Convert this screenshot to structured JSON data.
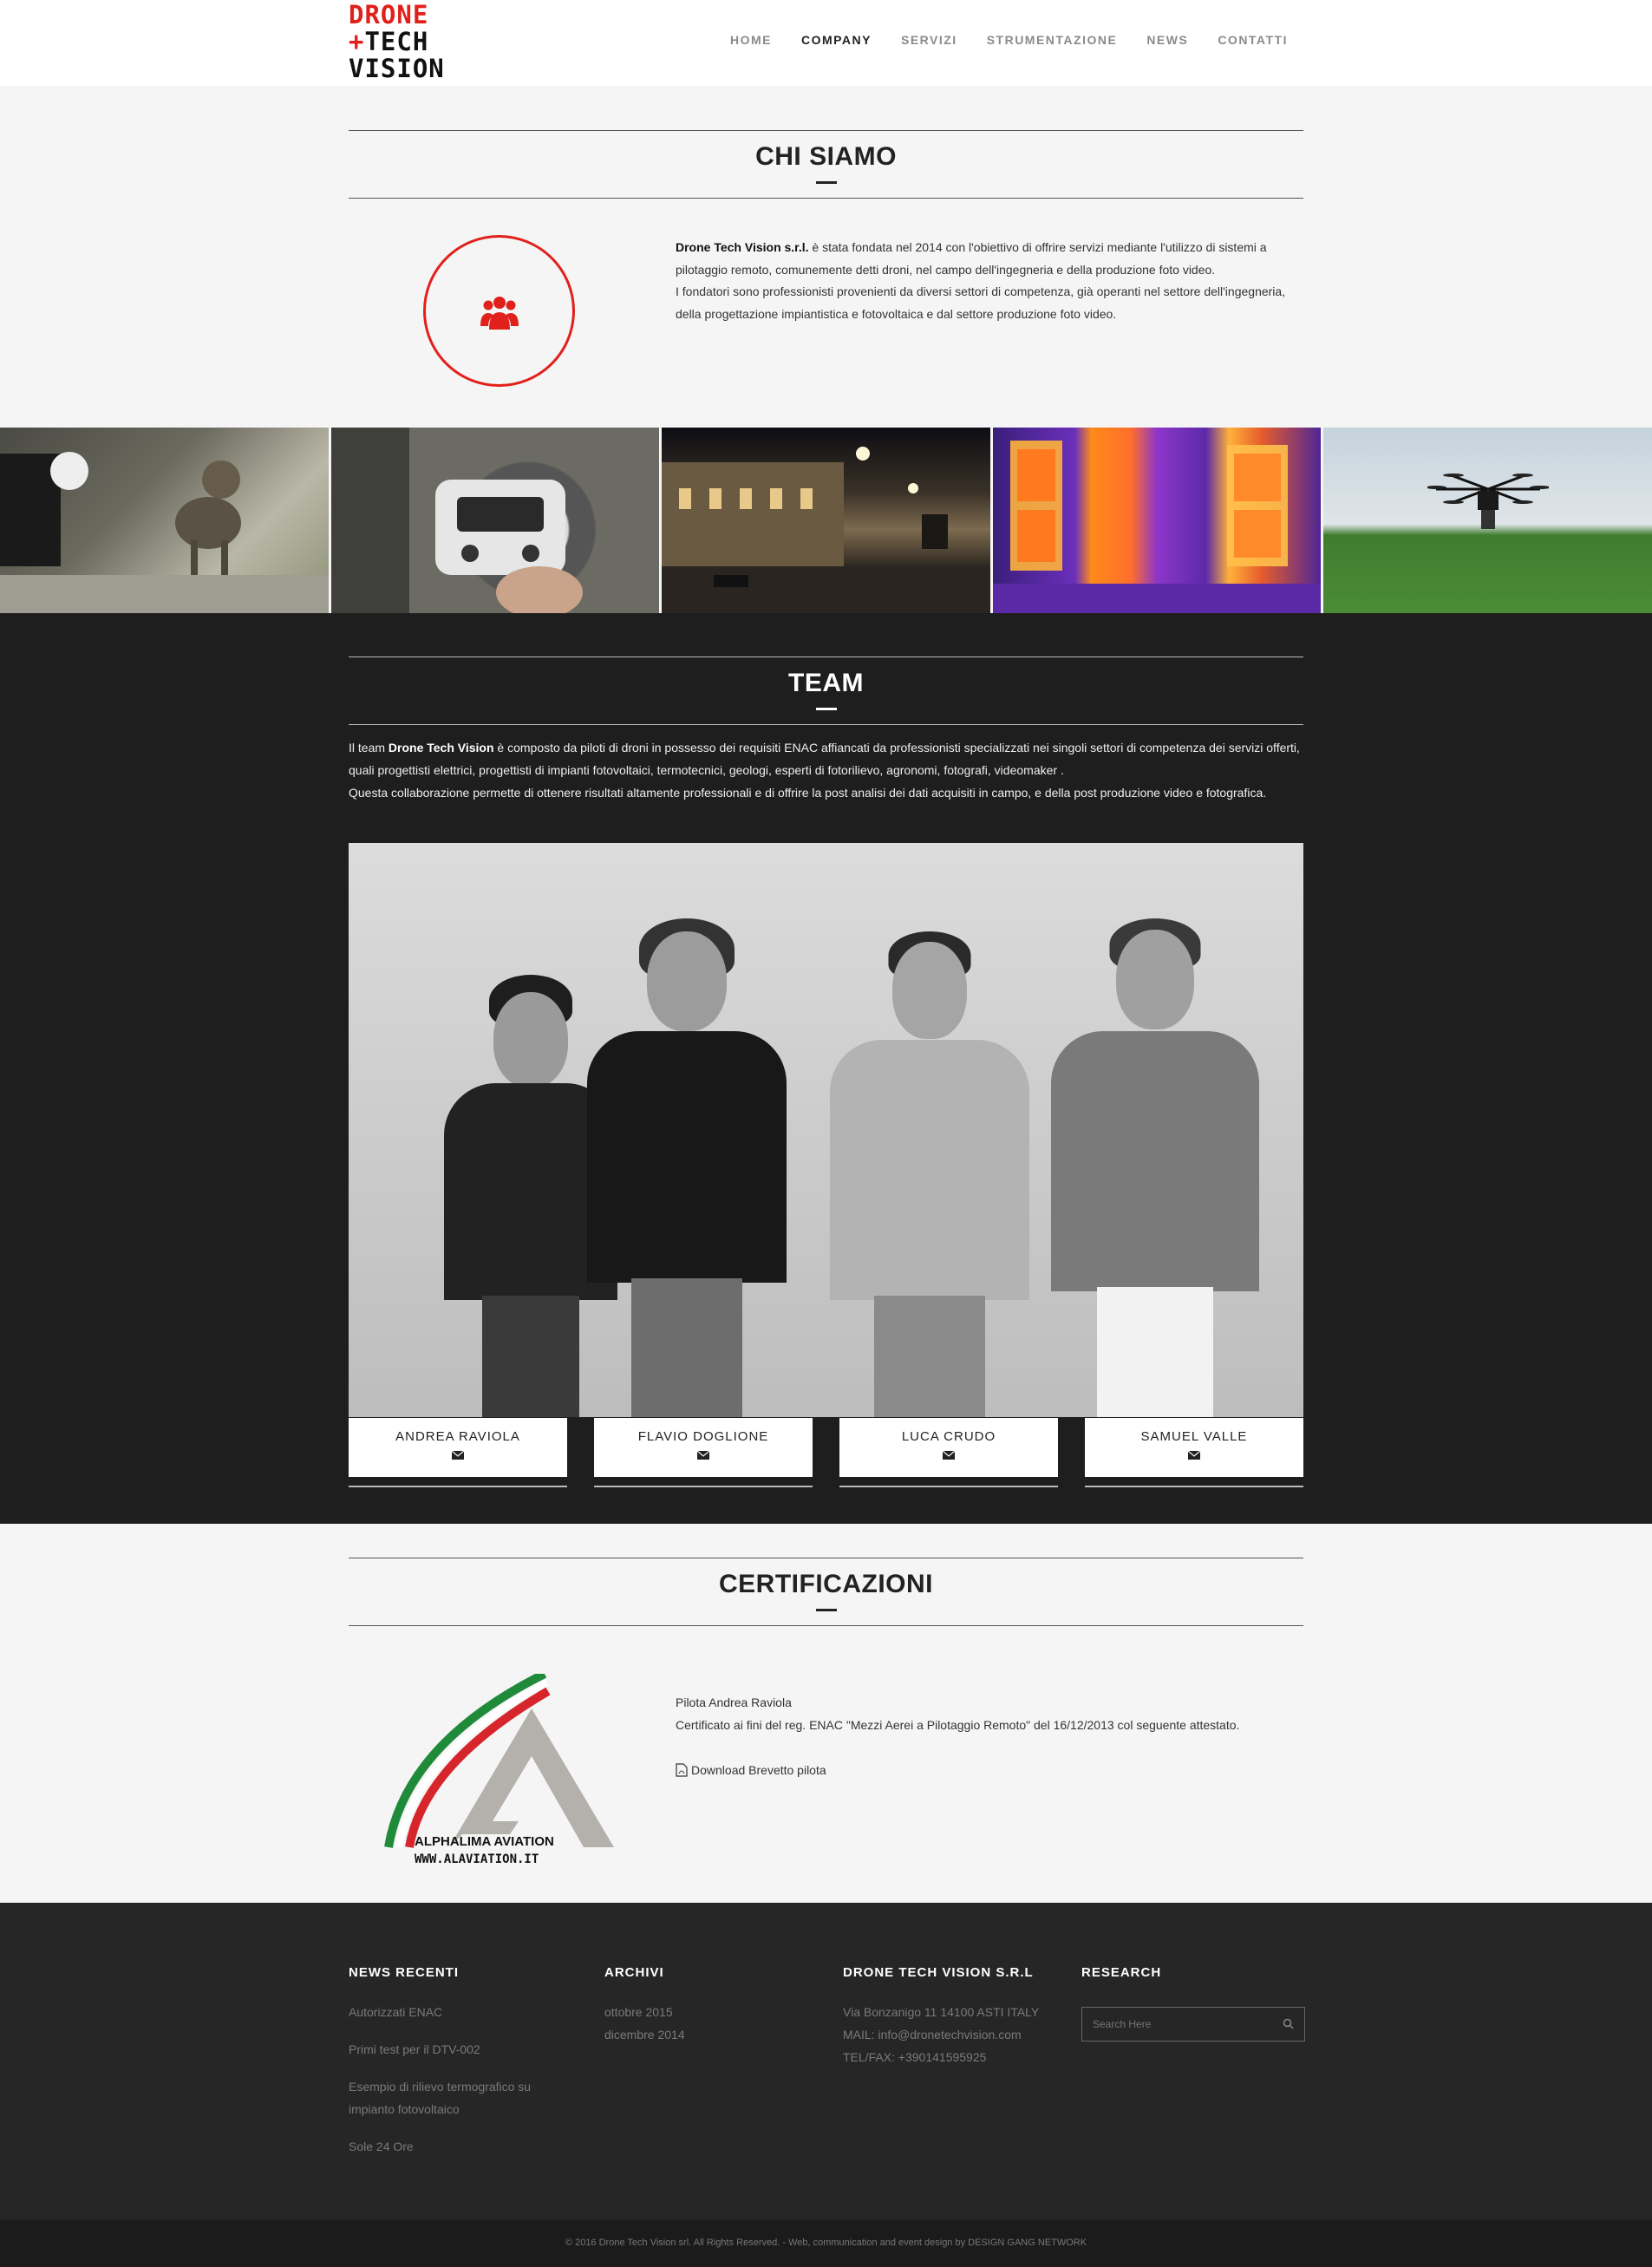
{
  "header": {
    "logo": {
      "line1": "DRONE",
      "line2": "TECH",
      "line3": "VISION"
    },
    "nav": [
      "HOME",
      "COMPANY",
      "SERVIZI",
      "STRUMENTAZIONE",
      "NEWS",
      "CONTATTI"
    ],
    "active_nav": "COMPANY"
  },
  "chi_siamo": {
    "title": "CHI SIAMO",
    "company": "Drone Tech Vision s.r.l.",
    "p1_rest": " è stata fondata nel 2014 con l'obiettivo di offrire servizi mediante l'utilizzo di sistemi a pilotaggio remoto, comunemente detti droni, nel campo dell'ingegneria e della produzione foto video.",
    "p2": "I fondatori sono professionisti provenienti da diversi settori di competenza, già operanti nel settore dell'ingegneria, della progettazione impiantistica e fotovoltaica e dal settore produzione foto video."
  },
  "team": {
    "title": "TEAM",
    "intro_pre": "Il team ",
    "intro_bold": "Drone Tech Vision",
    "intro_rest": " è composto da piloti di droni in possesso dei requisiti ENAC affiancati da professionisti specializzati nei singoli settori di competenza dei servizi offerti, quali progettisti elettrici, progettisti di impianti fotovoltaici, termotecnici, geologi, esperti di fotorilievo, agronomi, fotografi, videomaker .",
    "intro_p2": "Questa collaborazione permette di ottenere risultati altamente professionali e di offrire la post analisi dei dati acquisiti in campo, e della post produzione video e fotografica.",
    "members": [
      "ANDREA RAVIOLA",
      "FLAVIO DOGLIONE",
      "LUCA CRUDO",
      "SAMUEL VALLE"
    ]
  },
  "certificazioni": {
    "title": "CERTIFICAZIONI",
    "logo_text": "ALPHALIMA AVIATION",
    "logo_url": "WWW.ALAVIATION.IT",
    "line1": "Pilota Andrea Raviola",
    "line2": "Certificato ai fini del reg. ENAC \"Mezzi Aerei a Pilotaggio Remoto\" del 16/12/2013 col seguente attestato.",
    "download": "Download Brevetto pilota"
  },
  "footer": {
    "news_title": "NEWS RECENTI",
    "news": [
      "Autorizzati ENAC",
      "Primi test per il DTV-002",
      "Esempio di rilievo termografico su impianto fotovoltaico",
      "Sole 24 Ore"
    ],
    "archive_title": "ARCHIVI",
    "archives": [
      "ottobre 2015",
      "dicembre 2014"
    ],
    "company_title": "DRONE TECH VISION S.R.L",
    "address": "Via Bonzanigo 11 14100 ASTI ITALY",
    "mail": "MAIL: info@dronetechvision.com",
    "phone": "TEL/FAX: +390141595925",
    "research_title": "RESEARCH",
    "search_placeholder": "Search Here",
    "copyright": "© 2016 Drone Tech Vision srl. All Rights Reserved. - Web, communication and event design by DESIGN GANG NETWORK"
  },
  "colors": {
    "accent": "#e1201b",
    "dark": "#1e1e1e",
    "footer": "#262626"
  }
}
